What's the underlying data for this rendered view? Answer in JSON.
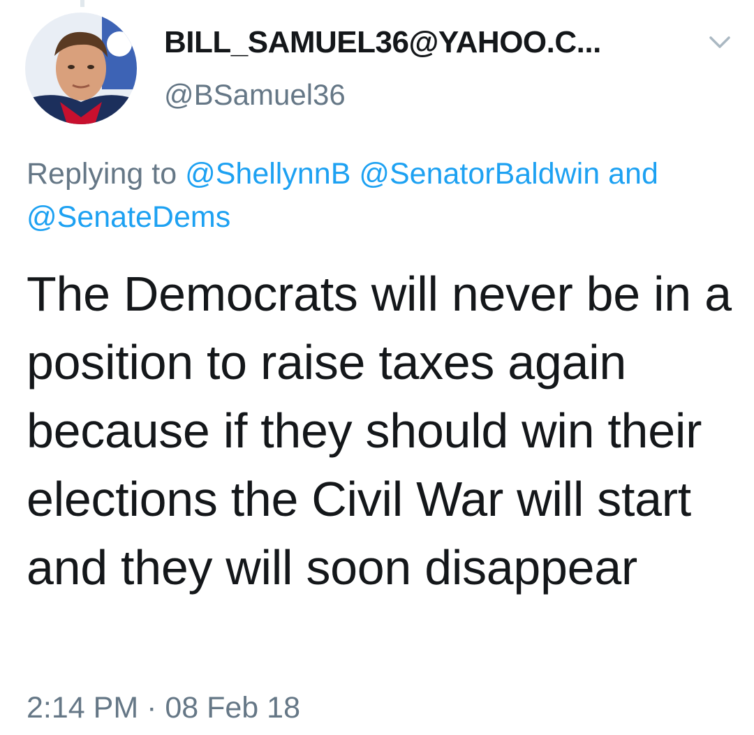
{
  "tweet": {
    "author": {
      "display_name": "BILL_SAMUEL36@YAHOO.C...",
      "handle": "@BSamuel36",
      "avatar_icon": "profile-photo"
    },
    "menu_icon": "chevron-down-icon",
    "reply_context": {
      "prefix": "Replying to",
      "mentions": [
        "@ShellynnB",
        "@SenatorBaldwin"
      ],
      "joiner": "and",
      "last_mention": "@SenateDems"
    },
    "text": "The Democrats will never be in a position to raise taxes again because if they should win their elections the Civil War will start and they will soon disappear",
    "timestamp": "2:14 PM · 08 Feb 18"
  },
  "colors": {
    "text_primary": "#14171a",
    "text_secondary": "#657786",
    "link": "#1da1f2",
    "chevron": "#aab8c2"
  }
}
